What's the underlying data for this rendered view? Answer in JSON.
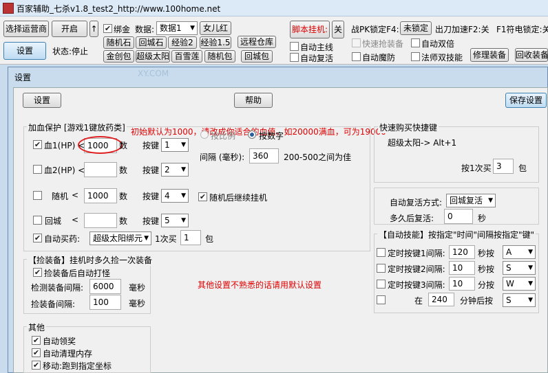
{
  "window": {
    "title": "百家辅助_七杀v1.8_test2_http://www.100home.net"
  },
  "toolbar": {
    "select_operator": "选择运营商",
    "start": "开启",
    "up_arrow": "↑",
    "settings": "设置",
    "status": "状态:停止",
    "bind_label": "绑金",
    "data_label": "数据:",
    "data_value": "数据1",
    "nv_erhong": "女儿红",
    "random_stone": "随机石",
    "return_stone": "回城石",
    "exp2": "经验2",
    "exp15": "经验1.5",
    "gold_bag": "金创包",
    "super_sun": "超级太阳",
    "hundred_lotus": "百雪莲",
    "random_bag": "随机包",
    "remote_warehouse": "远程仓库",
    "return_bag": "回城包",
    "script_hook": "脚本挂机:",
    "off": "关",
    "auto_main": "自动主线",
    "auto_revive": "自动复活",
    "pk_lock": "战PK锁定F4:",
    "unlock": "未锁定",
    "attack_speed": "出刀加速F2:关",
    "f1_lock": "F1符电锁定:关",
    "quick_buy": "快速抢装备",
    "auto_demon": "自动魔防",
    "auto_double": "自动双倍",
    "mage_skill": "法师双技能",
    "repair": "修理装备",
    "recycle": "回收装备"
  },
  "dialog": {
    "title": "设置",
    "tab_settings": "设置",
    "help": "帮助",
    "save": "保存设置",
    "watermark": "XY.COM"
  },
  "hp_group": {
    "title": "加血保护 [游戏1键放药类]",
    "note": "初始默认为1000，请改成你适合的血值，如20000满血，可为19000",
    "rows": [
      {
        "label": "血1(HP)  <",
        "value": "1000",
        "unit": "数",
        "key_label": "按键",
        "key": "1",
        "checked": "✔"
      },
      {
        "label": "血2(HP)  <",
        "value": "",
        "unit": "数",
        "key_label": "按键",
        "key": "2",
        "checked": ""
      },
      {
        "label": "随机",
        "lt": "<",
        "value": "1000",
        "unit": "数",
        "key_label": "按键",
        "key": "4",
        "checked": ""
      },
      {
        "label": "回城",
        "lt": "<",
        "value": "",
        "unit": "数",
        "key_label": "按键",
        "key": "5",
        "checked": ""
      }
    ],
    "by_ratio": "按比例",
    "by_number": "按数字",
    "interval_label": "间隔 (毫秒):",
    "interval_value": "360",
    "interval_hint": "200-500之间为佳",
    "continue_label": "随机后继续挂机",
    "auto_buy": "自动买药:",
    "auto_buy_item": "超级太阳绑元",
    "per_buy": "1次买",
    "per_buy_value": "1",
    "bag": "包"
  },
  "pick_group": {
    "title": "【捡装备】挂机时多久捡一次装备",
    "auto_sort": "捡装备后自动打怪",
    "detect_label": "检测装备间隔:",
    "detect_value": "6000",
    "pick_label": "捡装备间隔:",
    "pick_value": "100",
    "ms": "毫秒",
    "note": "其他设置不熟悉的话请用默认设置"
  },
  "other_group": {
    "title": "其他",
    "items": [
      "自动领奖",
      "自动清理内存",
      "移动:跑到指定坐标"
    ]
  },
  "quickbuy_group": {
    "title": "快速购买快捷键",
    "item": "超级太阳-> Alt+1",
    "per_label": "按1次买",
    "per_value": "3",
    "unit": "包"
  },
  "revive_group": {
    "label": "自动复活方式:",
    "mode": "回城复活",
    "delay_label": "多久后复活:",
    "delay_value": "0",
    "unit": "秒"
  },
  "skill_group": {
    "title": "【自动技能】按指定\"时间\"间隔按指定\"键\"",
    "rows": [
      {
        "label": "定时按键1间隔:",
        "value": "120",
        "unit": "秒按",
        "key": "A"
      },
      {
        "label": "定时按键2间隔:",
        "value": "10",
        "unit": "秒按",
        "key": "S"
      },
      {
        "label": "定时按键3间隔:",
        "value": "10",
        "unit": "分按",
        "key": "W"
      },
      {
        "label": "在",
        "value": "240",
        "unit": "分钟后按",
        "key": "S"
      }
    ]
  },
  "colors": {
    "accent": "#3c7fb1",
    "note_red": "#d00000"
  }
}
